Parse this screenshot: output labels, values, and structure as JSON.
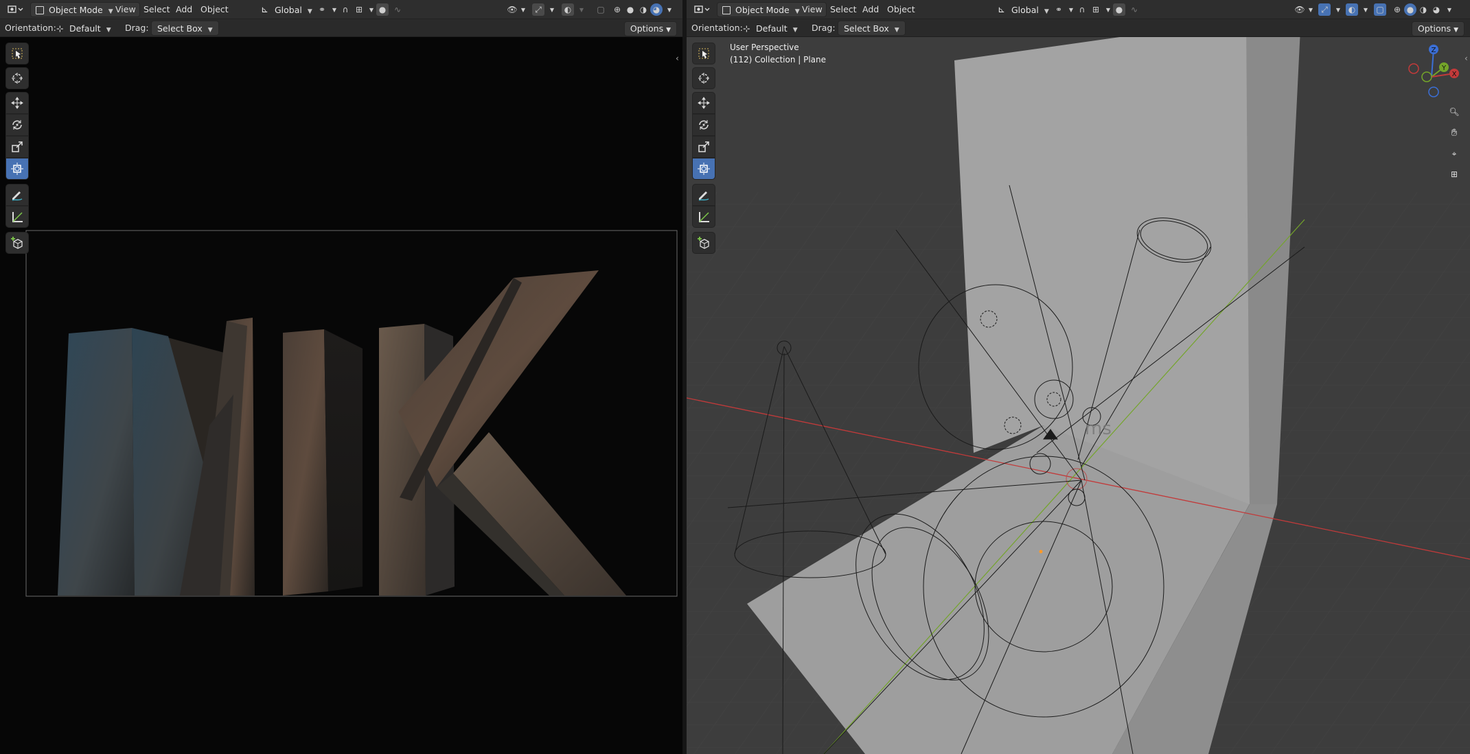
{
  "left_viewport": {
    "header": {
      "mode_label": "Object Mode",
      "menu_view": "View",
      "menu_select": "Select",
      "menu_add": "Add",
      "menu_object": "Object",
      "transform_orientation": "Global"
    },
    "tool_header": {
      "orientation_label": "Orientation:",
      "orientation_value": "Default",
      "drag_label": "Drag:",
      "drag_value": "Select Box",
      "options_label": "Options"
    },
    "camera_view": {
      "scene_text": "MIK"
    }
  },
  "right_viewport": {
    "header": {
      "mode_label": "Object Mode",
      "menu_view": "View",
      "menu_select": "Select",
      "menu_add": "Add",
      "menu_object": "Object",
      "transform_orientation": "Global"
    },
    "tool_header": {
      "orientation_label": "Orientation:",
      "orientation_value": "Default",
      "drag_label": "Drag:",
      "drag_value": "Select Box",
      "options_label": "Options"
    },
    "overlay": {
      "view_name": "User Perspective",
      "collection_info": "(112) Collection | Plane"
    },
    "gizmo": {
      "z_label": "Z",
      "y_label": "Y",
      "x_label": "X"
    },
    "scene_text_fragment": "ms"
  },
  "toolbar_tools": [
    "select-box",
    "cursor",
    "move",
    "rotate",
    "scale",
    "transform",
    "annotate",
    "measure",
    "add-cube"
  ],
  "colors": {
    "accent_active": "#4772b3",
    "axis_x": "#c23a3a",
    "axis_y": "#74a52a",
    "axis_z": "#3b6fd6",
    "left_viewport_bg": "#060606",
    "right_viewport_bg": "#3d3d3d"
  }
}
